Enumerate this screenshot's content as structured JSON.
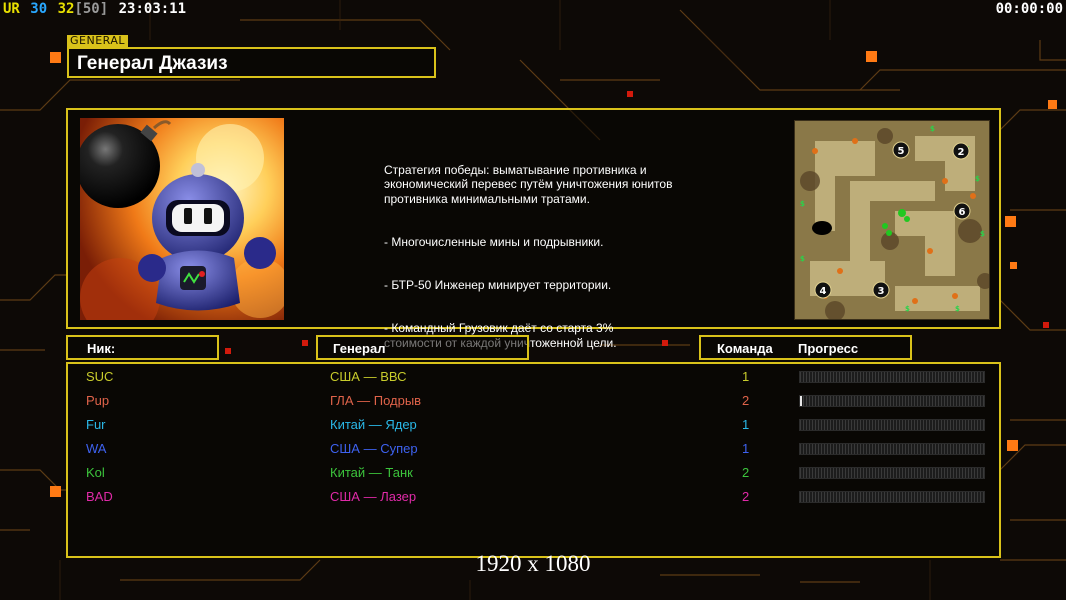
{
  "status": {
    "ur_label": "UR",
    "val1": "30",
    "val2": "32",
    "val3": "[50]",
    "clock": "23:03:11",
    "timer": "00:00:00",
    "colors": {
      "ur": "#e8e000",
      "val1": "#29a8ff",
      "val2": "#e8e000",
      "val3": "#9a9a9a",
      "clock": "#ffffff"
    }
  },
  "general": {
    "tag": "GENERAL",
    "name": "Генерал Джазиз",
    "portrait_icon": "bomberman-portrait",
    "map_icon": "minimap",
    "map_slots": [
      "5",
      "2",
      "6",
      "4",
      "3"
    ],
    "description": [
      "Стратегия победы: выматывание противника и\n экономический перевес путём уничтожения юнитов\n противника минимальными тратами.",
      "- Многочисленные мины и подрывники.",
      "- БТР-50 Инженер минирует территории.",
      "- Командный Грузовик даёт со старта 3%\n стоимости от каждой уничтоженной цели."
    ]
  },
  "columns": {
    "nick": "Ник:",
    "general": "Генерал",
    "team": "Команда",
    "progress": "Прогресс"
  },
  "players": [
    {
      "nick": "SUC",
      "general": "США — ВВС",
      "team": "1",
      "progress": 0.0,
      "color": "#c8cc2c"
    },
    {
      "nick": "Pup",
      "general": "ГЛА — Подрыв",
      "team": "2",
      "progress": 0.01,
      "color": "#e0634a"
    },
    {
      "nick": "Fur",
      "general": "Китай — Ядер",
      "team": "1",
      "progress": 0.0,
      "color": "#2ab8e8"
    },
    {
      "nick": "WA",
      "general": "США — Супер",
      "team": "1",
      "progress": 0.0,
      "color": "#3e62f0"
    },
    {
      "nick": "Kol",
      "general": "Китай — Танк",
      "team": "2",
      "progress": 0.0,
      "color": "#3cc43c"
    },
    {
      "nick": "BAD",
      "general": "США — Лазер",
      "team": "2",
      "progress": 0.0,
      "color": "#e02aa8"
    }
  ],
  "footer": {
    "resolution": "1920 x 1080"
  }
}
